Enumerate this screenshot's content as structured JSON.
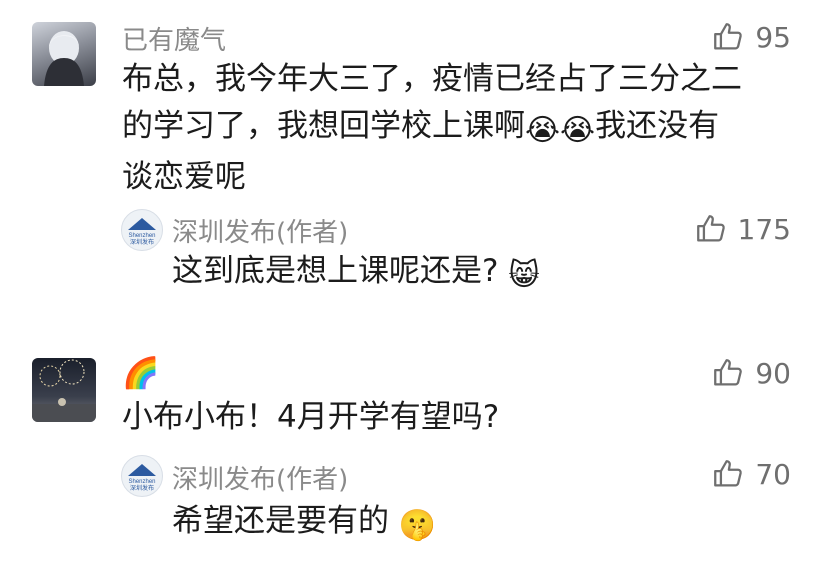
{
  "comments": [
    {
      "user": "已有魔气",
      "likes": "95",
      "text_line1": "布总，我今年大三了，疫情已经占了三分之二",
      "text_line2_a": "的学习了，我想回学校上课啊",
      "emoji_cry": "😭😭",
      "text_line2_b": "我还没有",
      "text_line3": "谈恋爱呢",
      "reply": {
        "user": "深圳发布(作者)",
        "likes": "175",
        "text": "这到底是想上课呢还是?",
        "emoji": "😸",
        "avatar_text_top": "Shenzhen",
        "avatar_text_bottom": "深圳发布"
      }
    },
    {
      "user": "🌈",
      "likes": "90",
      "text": "小布小布！4月开学有望吗?",
      "reply": {
        "user": "深圳发布(作者)",
        "likes": "70",
        "text": "希望还是要有的",
        "emoji": "🤫",
        "avatar_text_top": "Shenzhen",
        "avatar_text_bottom": "深圳发布"
      }
    }
  ],
  "icons": {
    "like": "thumbs-up-icon"
  },
  "colors": {
    "meta": "#8a8a8a",
    "text": "#1c1c1c",
    "like": "#6f6f6f"
  }
}
